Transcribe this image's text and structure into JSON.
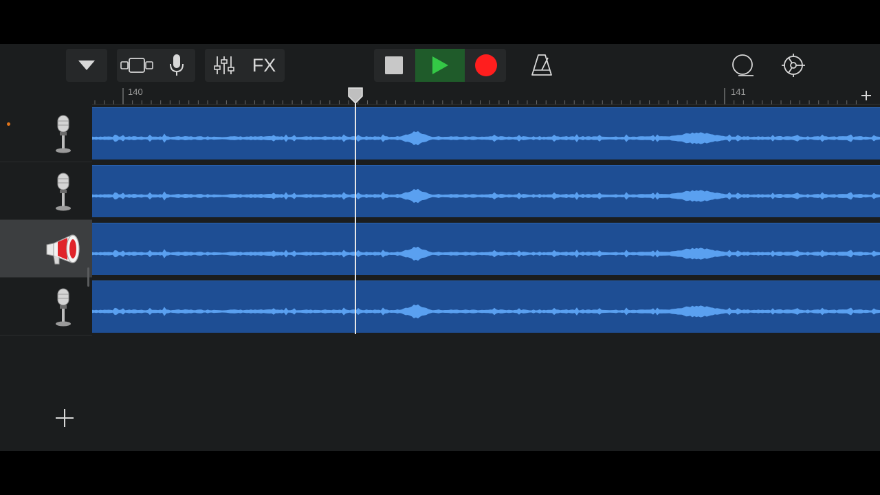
{
  "toolbar": {
    "fx_label": "FX",
    "icons": {
      "browser": "triangle-down-icon",
      "tracks_view": "tracks-view-icon",
      "instrument": "microphone-icon",
      "mixer": "mixer-sliders-icon",
      "fx": "fx-button",
      "stop": "stop-icon",
      "play": "play-icon",
      "record": "record-icon",
      "metronome": "metronome-icon",
      "loop": "loop-icon",
      "settings": "gear-icon"
    },
    "colors": {
      "play": "#34c846",
      "record": "#ff1e1e",
      "play_bg": "#1f5b2a"
    }
  },
  "ruler": {
    "bar_labels": [
      "140",
      "141"
    ]
  },
  "tracks": [
    {
      "instrument": "microphone",
      "selected": false,
      "recording_armed": true
    },
    {
      "instrument": "microphone",
      "selected": false,
      "recording_armed": false
    },
    {
      "instrument": "megaphone",
      "selected": true,
      "recording_armed": false
    },
    {
      "instrument": "microphone",
      "selected": false,
      "recording_armed": false
    }
  ],
  "region_color": "#1e4e94",
  "waveform_color": "#5aa0f0",
  "add_track_icon": "plus-icon"
}
